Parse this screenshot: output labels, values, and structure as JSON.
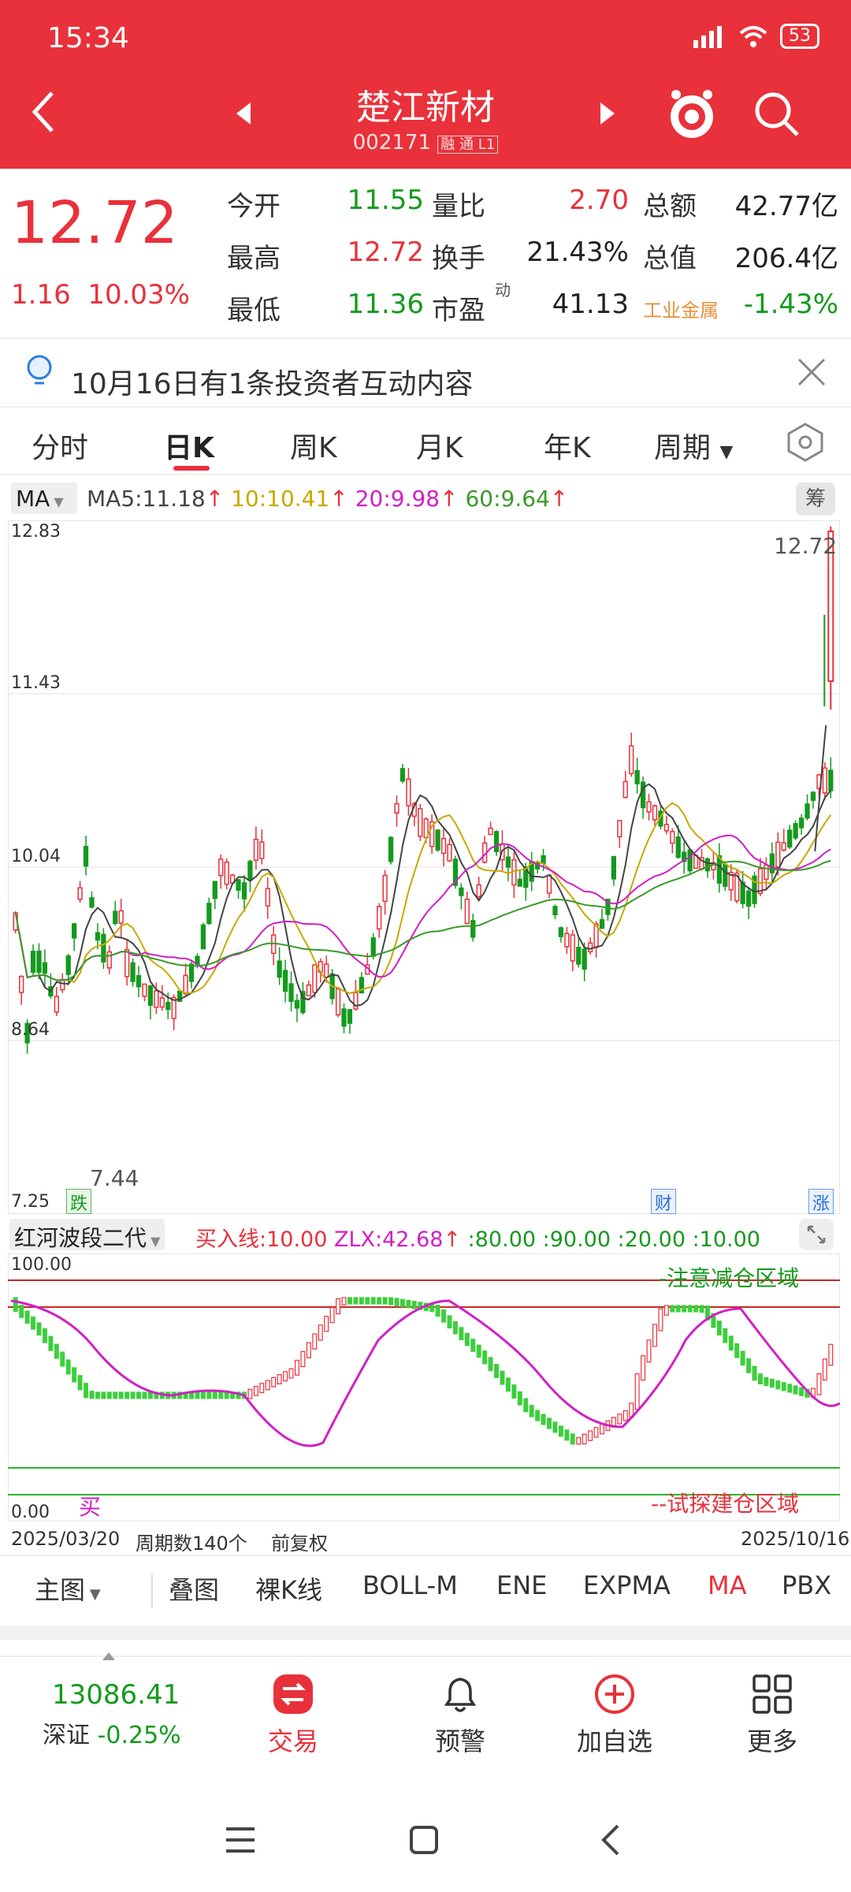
{
  "status": {
    "time": "15:34",
    "battery": "53"
  },
  "header": {
    "title": "楚江新材",
    "code": "002171",
    "tags": "融 通 L1"
  },
  "quote": {
    "price": "12.72",
    "change": "1.16",
    "change_pct": "10.03%",
    "rows": [
      [
        {
          "label": "今开",
          "value": "11.55",
          "color": "green"
        },
        {
          "label": "量比",
          "value": "2.70",
          "color": "red"
        },
        {
          "label": "总额",
          "value": "42.77亿",
          "color": "dark"
        }
      ],
      [
        {
          "label": "最高",
          "value": "12.72",
          "color": "red"
        },
        {
          "label": "换手",
          "value": "21.43%",
          "color": "dark"
        },
        {
          "label": "总值",
          "value": "206.4亿",
          "color": "dark"
        }
      ],
      [
        {
          "label": "最低",
          "value": "11.36",
          "color": "green"
        },
        {
          "label": "市盈",
          "value": "41.13",
          "color": "dark"
        },
        {
          "label": "工业金属",
          "value": "-1.43%",
          "color": "green"
        }
      ]
    ],
    "pe_suffix": "动"
  },
  "notice": {
    "text": "10月16日有1条投资者互动内容"
  },
  "tabs": [
    "分时",
    "日K",
    "周K",
    "月K",
    "年K",
    "周期"
  ],
  "ma": {
    "selector": "MA",
    "ma5": "MA5:11.18",
    "ma10": "10:10.41",
    "ma20": "20:9.98",
    "ma60": "60:9.64",
    "chip_label": "筹"
  },
  "main_chart": {
    "ticks": [
      "12.83",
      "11.43",
      "10.04",
      "8.64",
      "7.25"
    ],
    "high_label": "12.72",
    "low_label": "7.44",
    "markers": [
      "跌",
      "财",
      "涨"
    ]
  },
  "indicator": {
    "name": "红河波段二代",
    "buy_line": "买入线:10.00",
    "zlx": "ZLX:42.68",
    "levels": ":80.00 :90.00 :20.00 :10.00",
    "top": "100.00",
    "bottom": "0.00",
    "zone_top": "-注意减仓区域",
    "zone_bottom": "--试探建仓区域",
    "buy_mark": "买"
  },
  "footer_info": {
    "start": "2025/03/20",
    "period": "周期数140个",
    "adjust": "前复权",
    "end": "2025/10/16"
  },
  "ind_bar": [
    "主图",
    "叠图",
    "裸K线",
    "BOLL-M",
    "ENE",
    "EXPMA",
    "MA",
    "PBX"
  ],
  "bottom_nav": {
    "index_value": "13086.41",
    "index_name": "深证",
    "index_pct": "-0.25%",
    "items": [
      "交易",
      "预警",
      "加自选",
      "更多"
    ]
  },
  "colors": {
    "accent": "#e8313a",
    "up": "#e8313a",
    "down": "#139a1d",
    "ma5": "#444444",
    "ma10": "#c9a800",
    "ma20": "#d21fc4",
    "ma60": "#3a9a2a"
  }
}
